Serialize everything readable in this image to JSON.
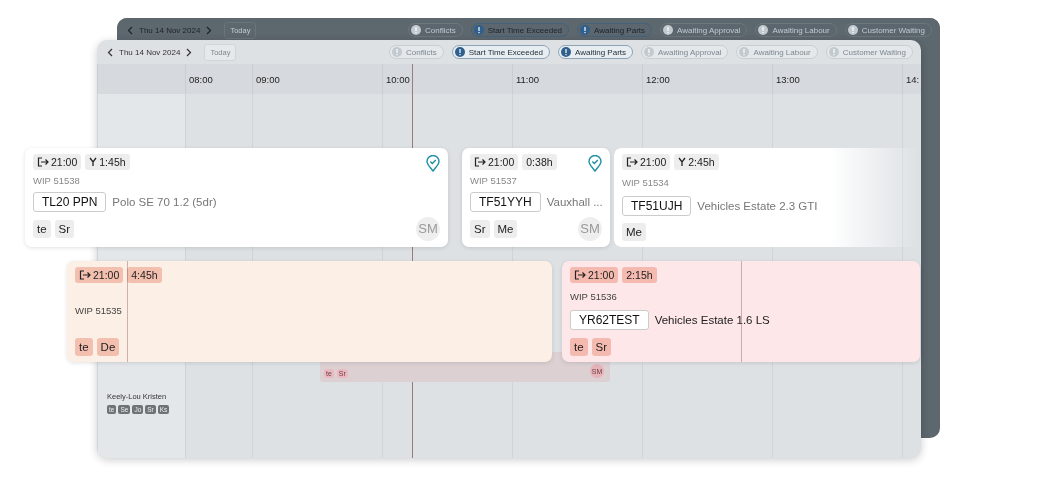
{
  "back_toolbar": {
    "date": "Thu 14 Nov 2024",
    "today": "Today",
    "filters": [
      {
        "label": "Conflicts",
        "selected": false
      },
      {
        "label": "Start Time Exceeded",
        "selected": true
      },
      {
        "label": "Awaiting Parts",
        "selected": true
      },
      {
        "label": "Awaiting Approval",
        "selected": false
      },
      {
        "label": "Awaiting Labour",
        "selected": false
      },
      {
        "label": "Customer Waiting",
        "selected": false
      }
    ]
  },
  "front_toolbar": {
    "date": "Thu 14 Nov 2024",
    "today": "Today",
    "filters": [
      {
        "label": "Conflicts",
        "selected": false
      },
      {
        "label": "Start Time Exceeded",
        "selected": true
      },
      {
        "label": "Awaiting Parts",
        "selected": true
      },
      {
        "label": "Awaiting Approval",
        "selected": false
      },
      {
        "label": "Awaiting Labour",
        "selected": false
      },
      {
        "label": "Customer Waiting",
        "selected": false
      }
    ]
  },
  "hours": [
    "08:00",
    "09:00",
    "10:00",
    "11:00",
    "12:00",
    "13:00",
    "14:"
  ],
  "background_job": {
    "tags": [
      "te",
      "Sr"
    ],
    "assignee": "SM"
  },
  "technician": {
    "name": "Keely-Lou Kristen",
    "skills": [
      "te",
      "Se",
      "Jo",
      "Sr",
      "Ks"
    ]
  },
  "jobs": [
    {
      "color": "#ffffff",
      "start": "21:00",
      "duration": "1:45h",
      "split": true,
      "wip": "WIP 51538",
      "plate": "TL20 PPN",
      "vehicle": "Polo SE 70 1.2 (5dr)",
      "tags": [
        "te",
        "Sr"
      ],
      "assignee": "SM",
      "verified": true
    },
    {
      "color": "#ffffff",
      "start": "21:00",
      "duration": "0:38h",
      "split": false,
      "wip": "WIP 51537",
      "plate": "TF51YYH",
      "vehicle": "Vauxhall ...",
      "tags": [
        "Sr",
        "Me"
      ],
      "assignee": "SM",
      "verified": true
    },
    {
      "color": "#ffffff",
      "start": "21:00",
      "duration": "2:45h",
      "split": true,
      "wip": "WIP 51534",
      "plate": "TF51UJH",
      "vehicle": "Vehicles Estate 2.3 GTI",
      "tags": [
        "Me"
      ],
      "verified": false
    },
    {
      "color": "#fcefe5",
      "start": "21:00",
      "duration": "4:45h",
      "split": false,
      "wip": "WIP 51535",
      "tags": [
        "te",
        "De"
      ],
      "verified": false
    },
    {
      "color": "#fde7e8",
      "start": "21:00",
      "duration": "2:15h",
      "split": false,
      "wip": "WIP 51536",
      "plate": "YR62TEST",
      "vehicle": "Vehicles Estate 1.6 LS",
      "tags": [
        "te",
        "Sr"
      ],
      "verified": false
    }
  ]
}
